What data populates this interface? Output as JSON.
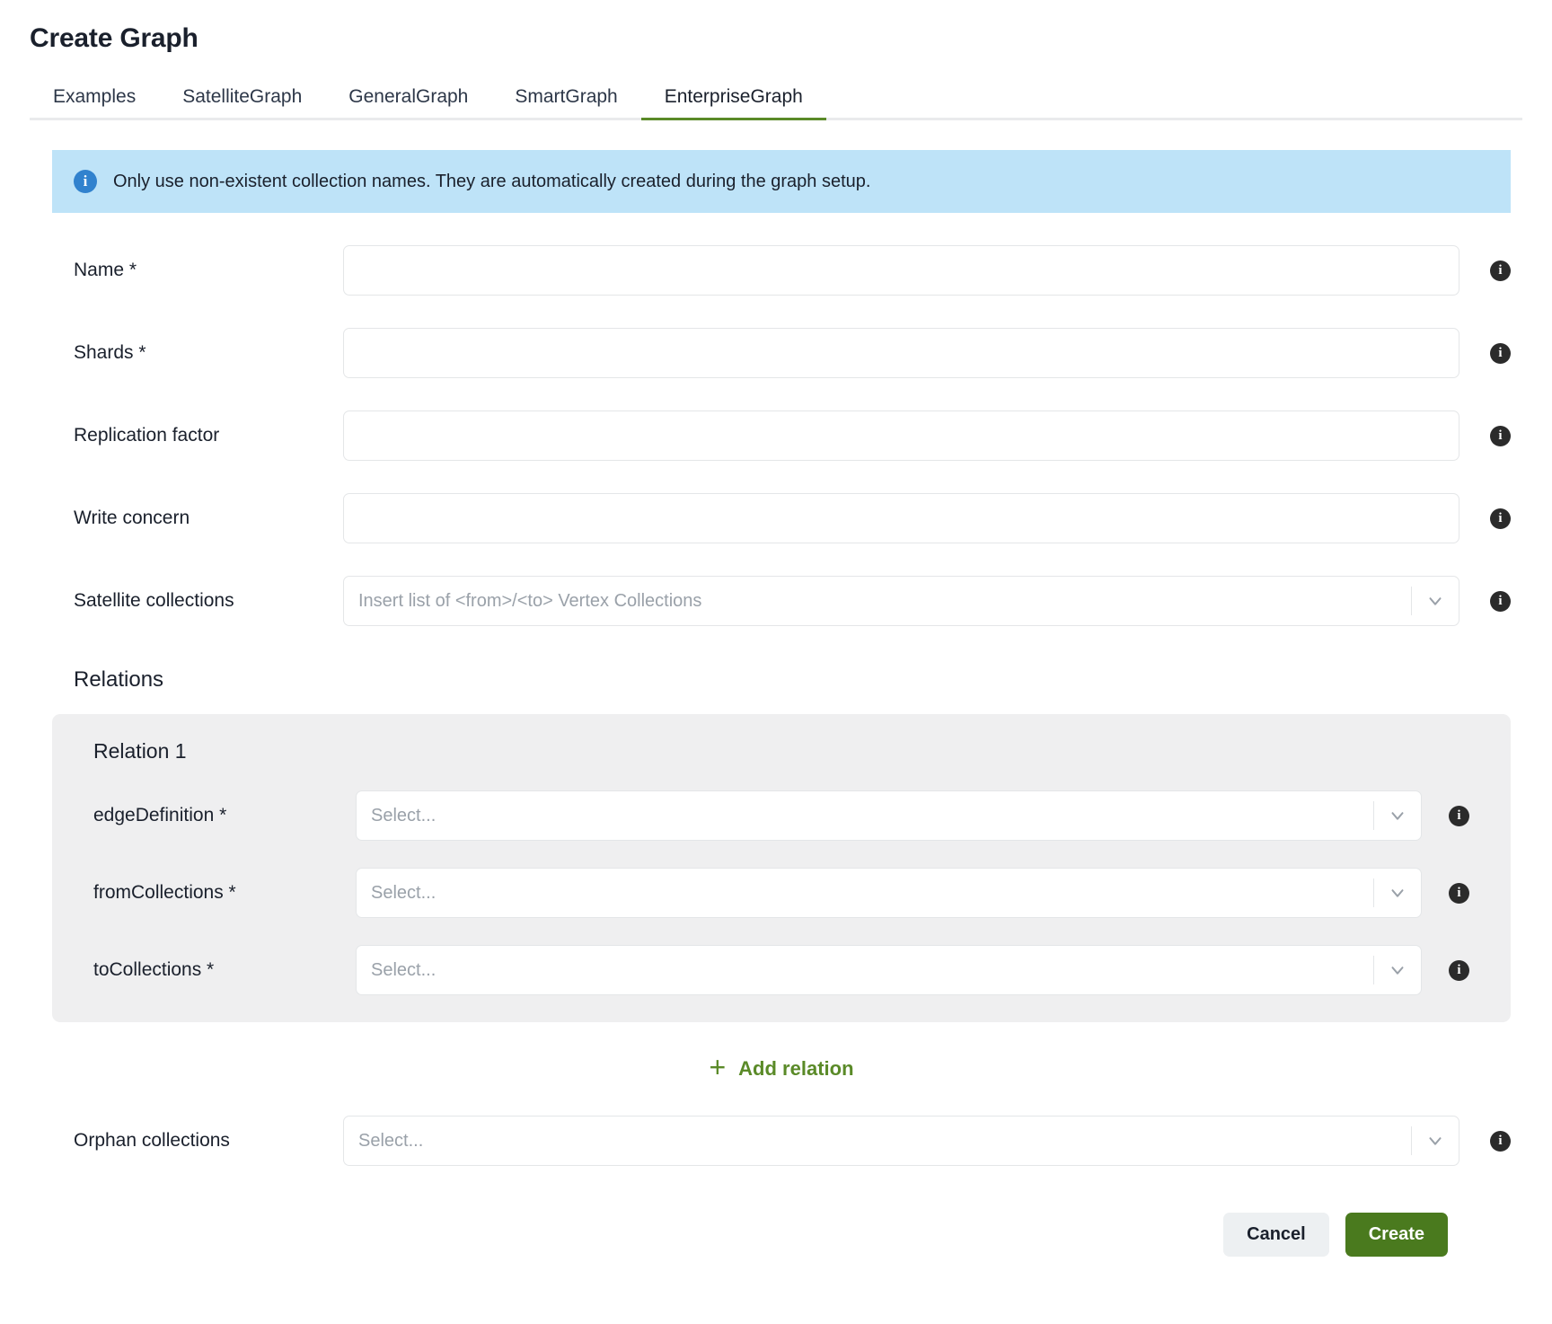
{
  "header": {
    "title": "Create Graph"
  },
  "tabs": [
    {
      "label": "Examples",
      "active": false
    },
    {
      "label": "SatelliteGraph",
      "active": false
    },
    {
      "label": "GeneralGraph",
      "active": false
    },
    {
      "label": "SmartGraph",
      "active": false
    },
    {
      "label": "EnterpriseGraph",
      "active": true
    }
  ],
  "banner": {
    "icon": "info-icon",
    "text": "Only use non-existent collection names. They are automatically created during the graph setup.",
    "background": "#bee3f8",
    "icon_color": "#3182ce"
  },
  "fields": {
    "name": {
      "label": "Name *",
      "value": "",
      "placeholder": ""
    },
    "shards": {
      "label": "Shards *",
      "value": "",
      "placeholder": ""
    },
    "replication_factor": {
      "label": "Replication factor",
      "value": "",
      "placeholder": ""
    },
    "write_concern": {
      "label": "Write concern",
      "value": "",
      "placeholder": ""
    },
    "satellite_collections": {
      "label": "Satellite collections",
      "placeholder": "Insert list of <from>/<to> Vertex Collections"
    },
    "orphan_collections": {
      "label": "Orphan collections",
      "placeholder": "Select..."
    }
  },
  "relations": {
    "section_title": "Relations",
    "items": [
      {
        "title": "Relation 1",
        "edge_definition": {
          "label": "edgeDefinition *",
          "placeholder": "Select..."
        },
        "from_collections": {
          "label": "fromCollections *",
          "placeholder": "Select..."
        },
        "to_collections": {
          "label": "toCollections *",
          "placeholder": "Select..."
        }
      }
    ],
    "add_label": "Add relation",
    "add_icon": "plus-icon"
  },
  "footer": {
    "cancel_label": "Cancel",
    "create_label": "Create",
    "create_color": "#4a7a1e",
    "cancel_color": "#edf0f2"
  },
  "info_glyph": "i"
}
